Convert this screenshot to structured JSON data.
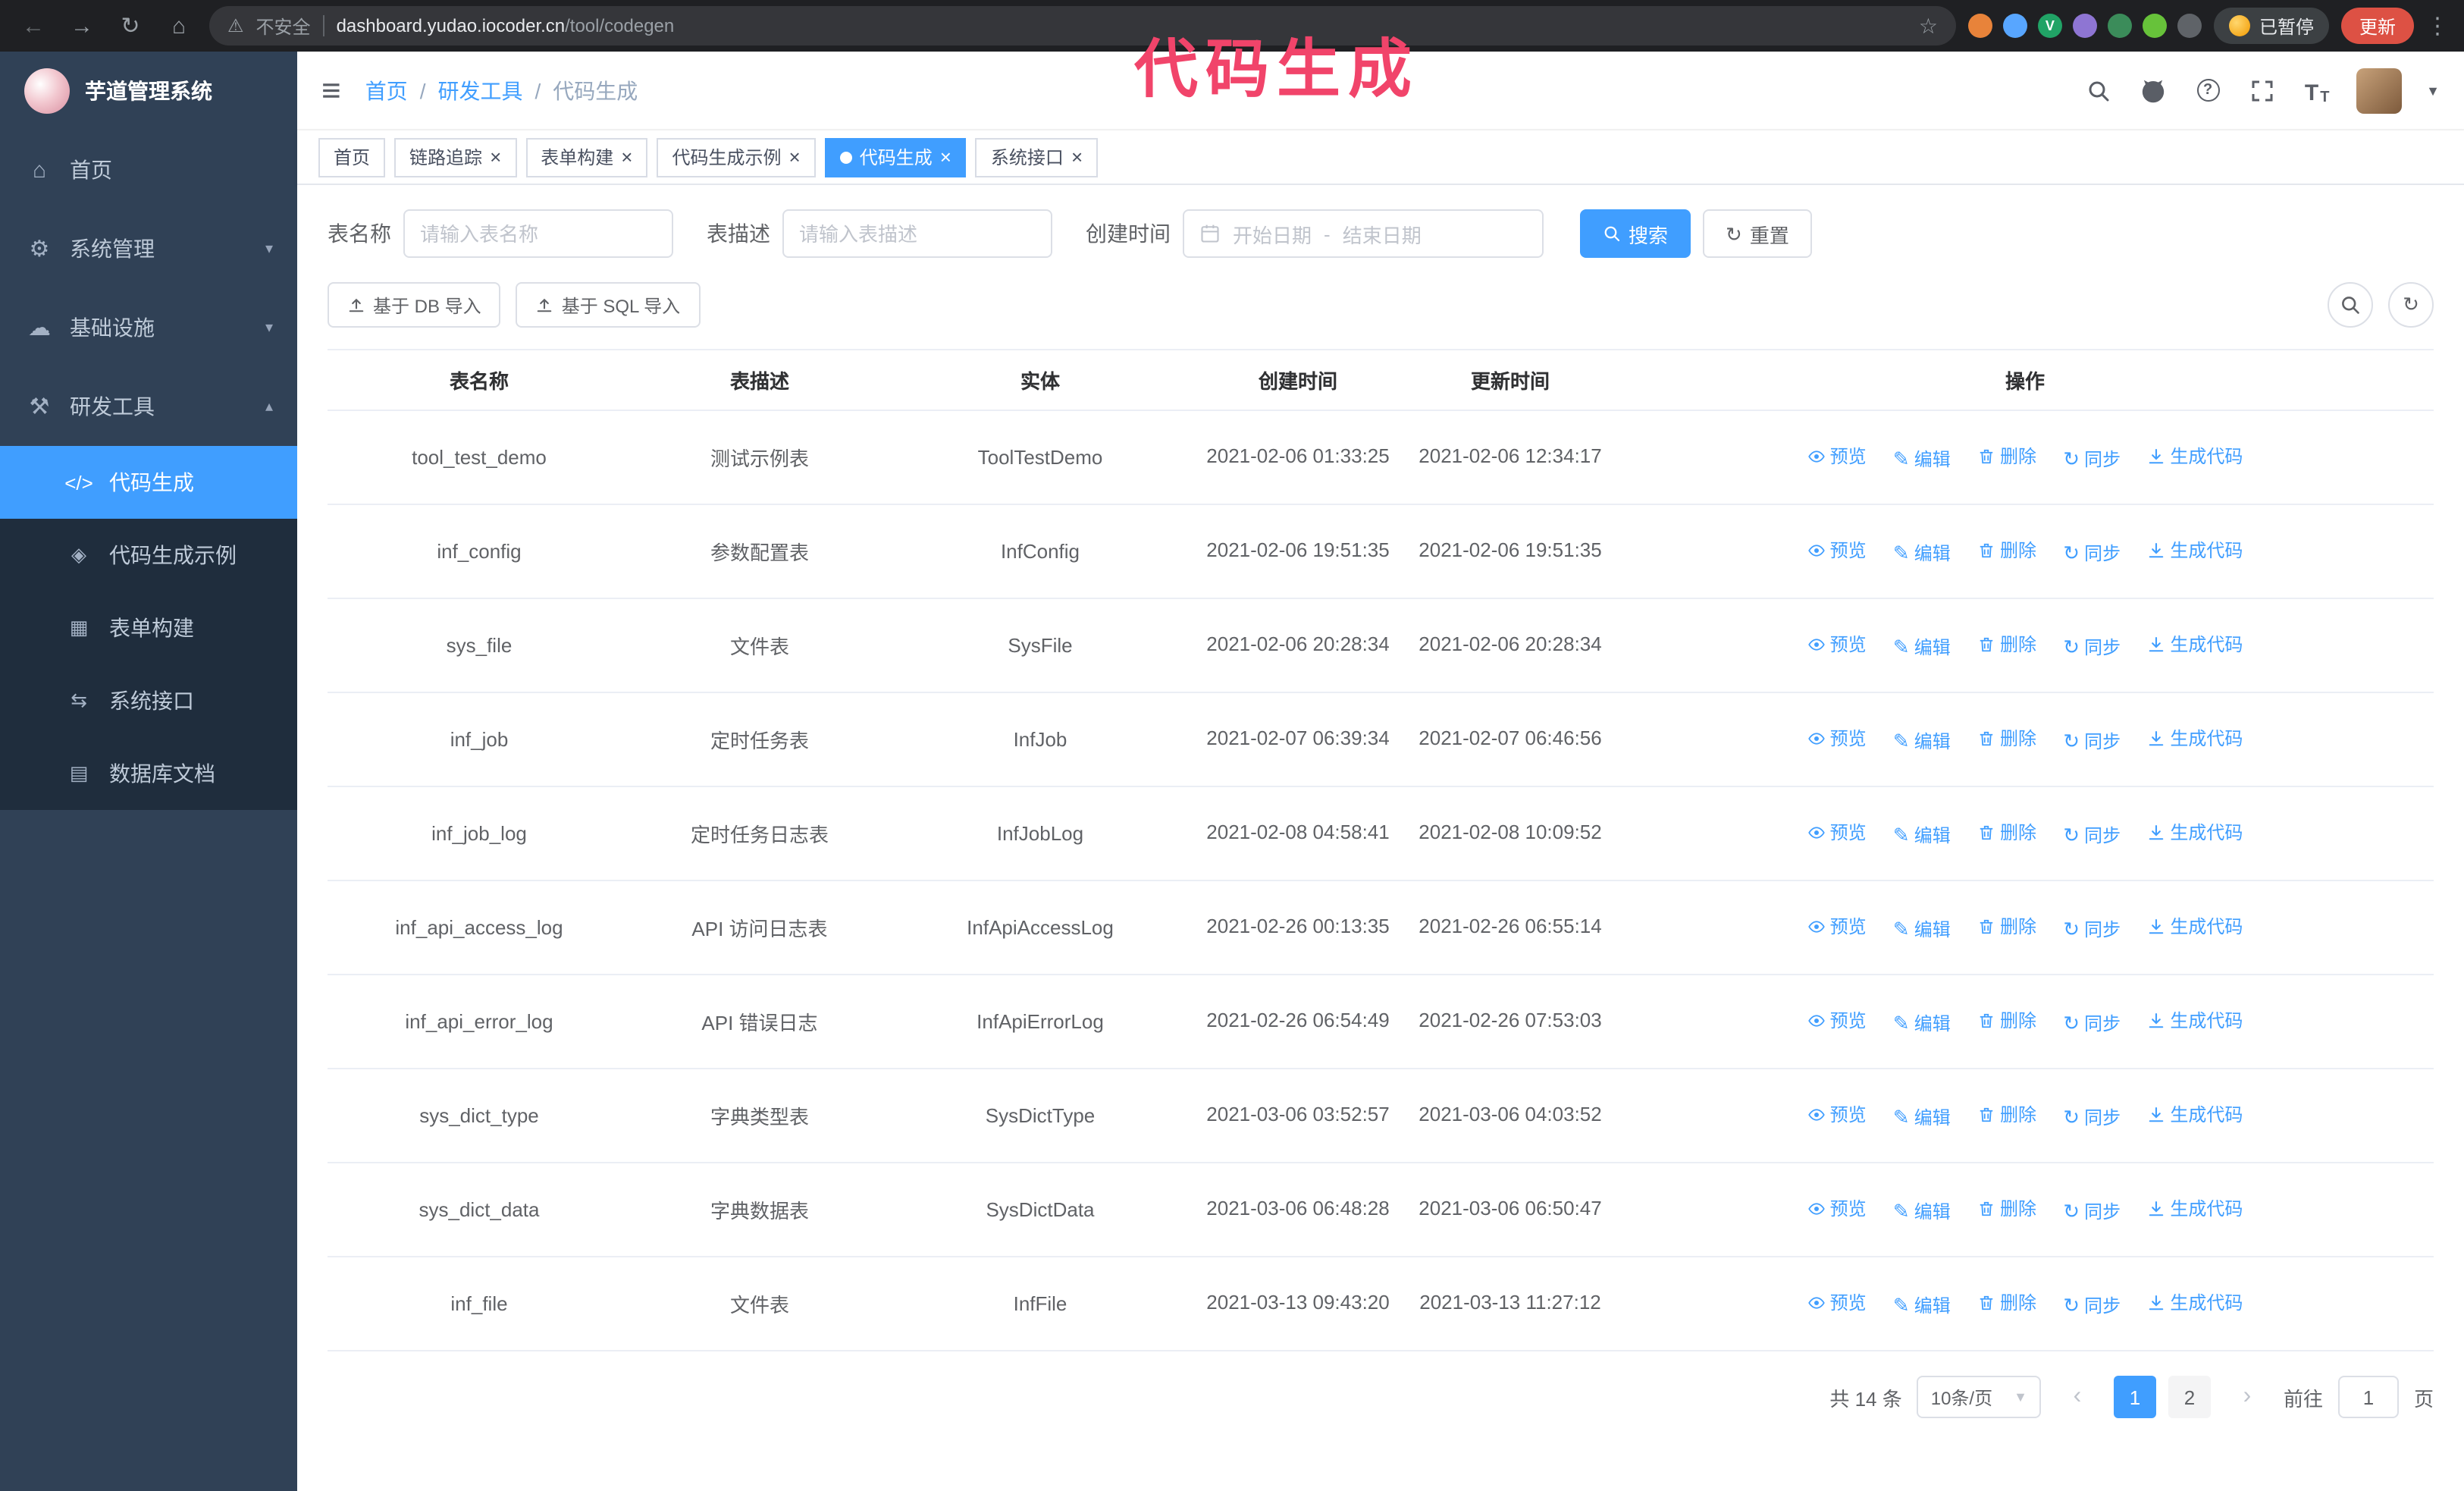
{
  "colors": {
    "primary": "#409eff",
    "annotation": "#f1446a",
    "sidebar_bg": "#304156",
    "submenu_bg": "#1f2d3d"
  },
  "annotation": {
    "title": "代码生成"
  },
  "browser": {
    "security_warning": "不安全",
    "url_host": "dashboard.yudao.iocoder.cn",
    "url_path": "/tool/codegen",
    "paused_button": "已暂停",
    "update_button": "更新",
    "extensions": [
      {
        "name": "extension-icon-orange",
        "color": "#e8833a",
        "letter": ""
      },
      {
        "name": "extension-icon-lightblue",
        "color": "#58a6ff",
        "letter": ""
      },
      {
        "name": "extension-icon-green-v",
        "color": "#21a366",
        "letter": "V"
      },
      {
        "name": "extension-icon-people",
        "color": "#8e75d3",
        "letter": ""
      },
      {
        "name": "extension-icon-chart",
        "color": "#3b8c5a",
        "letter": ""
      },
      {
        "name": "extension-icon-leaf",
        "color": "#67c23a",
        "letter": ""
      },
      {
        "name": "extension-icon-puzzle",
        "color": "#5f6368",
        "letter": ""
      }
    ]
  },
  "sidebar": {
    "logo_title": "芋道管理系统",
    "items": [
      {
        "label": "首页",
        "icon": "home-icon",
        "glyph": "⌂",
        "chevron": ""
      },
      {
        "label": "系统管理",
        "icon": "gear-icon",
        "glyph": "⚙",
        "chevron": "▾"
      },
      {
        "label": "基础设施",
        "icon": "infrastructure-icon",
        "glyph": "☁",
        "chevron": "▾"
      },
      {
        "label": "研发工具",
        "icon": "dev-tools-icon",
        "glyph": "⚒",
        "chevron": "▴"
      }
    ],
    "sub_items": [
      {
        "label": "代码生成",
        "icon": "code-generation-icon",
        "glyph": "</>",
        "active": true
      },
      {
        "label": "代码生成示例",
        "icon": "code-example-icon",
        "glyph": "◈",
        "active": false
      },
      {
        "label": "表单构建",
        "icon": "form-builder-icon",
        "glyph": "▦",
        "active": false
      },
      {
        "label": "系统接口",
        "icon": "system-api-icon",
        "glyph": "⇆",
        "active": false
      },
      {
        "label": "数据库文档",
        "icon": "db-doc-icon",
        "glyph": "▤",
        "active": false
      }
    ]
  },
  "header": {
    "breadcrumb": [
      "首页",
      "研发工具",
      "代码生成"
    ],
    "separator": "/"
  },
  "tags": [
    {
      "label": "首页",
      "closable": false,
      "active": false
    },
    {
      "label": "链路追踪",
      "closable": true,
      "active": false
    },
    {
      "label": "表单构建",
      "closable": true,
      "active": false
    },
    {
      "label": "代码生成示例",
      "closable": true,
      "active": false
    },
    {
      "label": "代码生成",
      "closable": true,
      "active": true
    },
    {
      "label": "系统接口",
      "closable": true,
      "active": false
    }
  ],
  "filters": {
    "table_name_label": "表名称",
    "table_name_placeholder": "请输入表名称",
    "table_desc_label": "表描述",
    "table_desc_placeholder": "请输入表描述",
    "create_time_label": "创建时间",
    "start_date_placeholder": "开始日期",
    "range_separator": "-",
    "end_date_placeholder": "结束日期",
    "search_button": "搜索",
    "reset_button": "重置"
  },
  "toolbar": {
    "import_db_button": "基于 DB 导入",
    "import_sql_button": "基于 SQL 导入"
  },
  "table": {
    "columns": [
      "表名称",
      "表描述",
      "实体",
      "创建时间",
      "更新时间",
      "操作"
    ],
    "actions": [
      "预览",
      "编辑",
      "删除",
      "同步",
      "生成代码"
    ],
    "rows": [
      {
        "name": "tool_test_demo",
        "desc": "测试示例表",
        "entity": "ToolTestDemo",
        "created": "2021-02-06 01:33:25",
        "updated": "2021-02-06 12:34:17"
      },
      {
        "name": "inf_config",
        "desc": "参数配置表",
        "entity": "InfConfig",
        "created": "2021-02-06 19:51:35",
        "updated": "2021-02-06 19:51:35"
      },
      {
        "name": "sys_file",
        "desc": "文件表",
        "entity": "SysFile",
        "created": "2021-02-06 20:28:34",
        "updated": "2021-02-06 20:28:34"
      },
      {
        "name": "inf_job",
        "desc": "定时任务表",
        "entity": "InfJob",
        "created": "2021-02-07 06:39:34",
        "updated": "2021-02-07 06:46:56"
      },
      {
        "name": "inf_job_log",
        "desc": "定时任务日志表",
        "entity": "InfJobLog",
        "created": "2021-02-08 04:58:41",
        "updated": "2021-02-08 10:09:52"
      },
      {
        "name": "inf_api_access_log",
        "desc": "API 访问日志表",
        "entity": "InfApiAccessLog",
        "created": "2021-02-26 00:13:35",
        "updated": "2021-02-26 06:55:14"
      },
      {
        "name": "inf_api_error_log",
        "desc": "API 错误日志",
        "entity": "InfApiErrorLog",
        "created": "2021-02-26 06:54:49",
        "updated": "2021-02-26 07:53:03"
      },
      {
        "name": "sys_dict_type",
        "desc": "字典类型表",
        "entity": "SysDictType",
        "created": "2021-03-06 03:52:57",
        "updated": "2021-03-06 04:03:52"
      },
      {
        "name": "sys_dict_data",
        "desc": "字典数据表",
        "entity": "SysDictData",
        "created": "2021-03-06 06:48:28",
        "updated": "2021-03-06 06:50:47"
      },
      {
        "name": "inf_file",
        "desc": "文件表",
        "entity": "InfFile",
        "created": "2021-03-13 09:43:20",
        "updated": "2021-03-13 11:27:12"
      }
    ]
  },
  "pagination": {
    "total": "共 14 条",
    "page_size": "10条/页",
    "prev_icon": "‹",
    "next_icon": "›",
    "pages": [
      "1",
      "2"
    ],
    "active_page": "1",
    "goto_label": "前往",
    "goto_value": "1",
    "goto_suffix": "页"
  }
}
